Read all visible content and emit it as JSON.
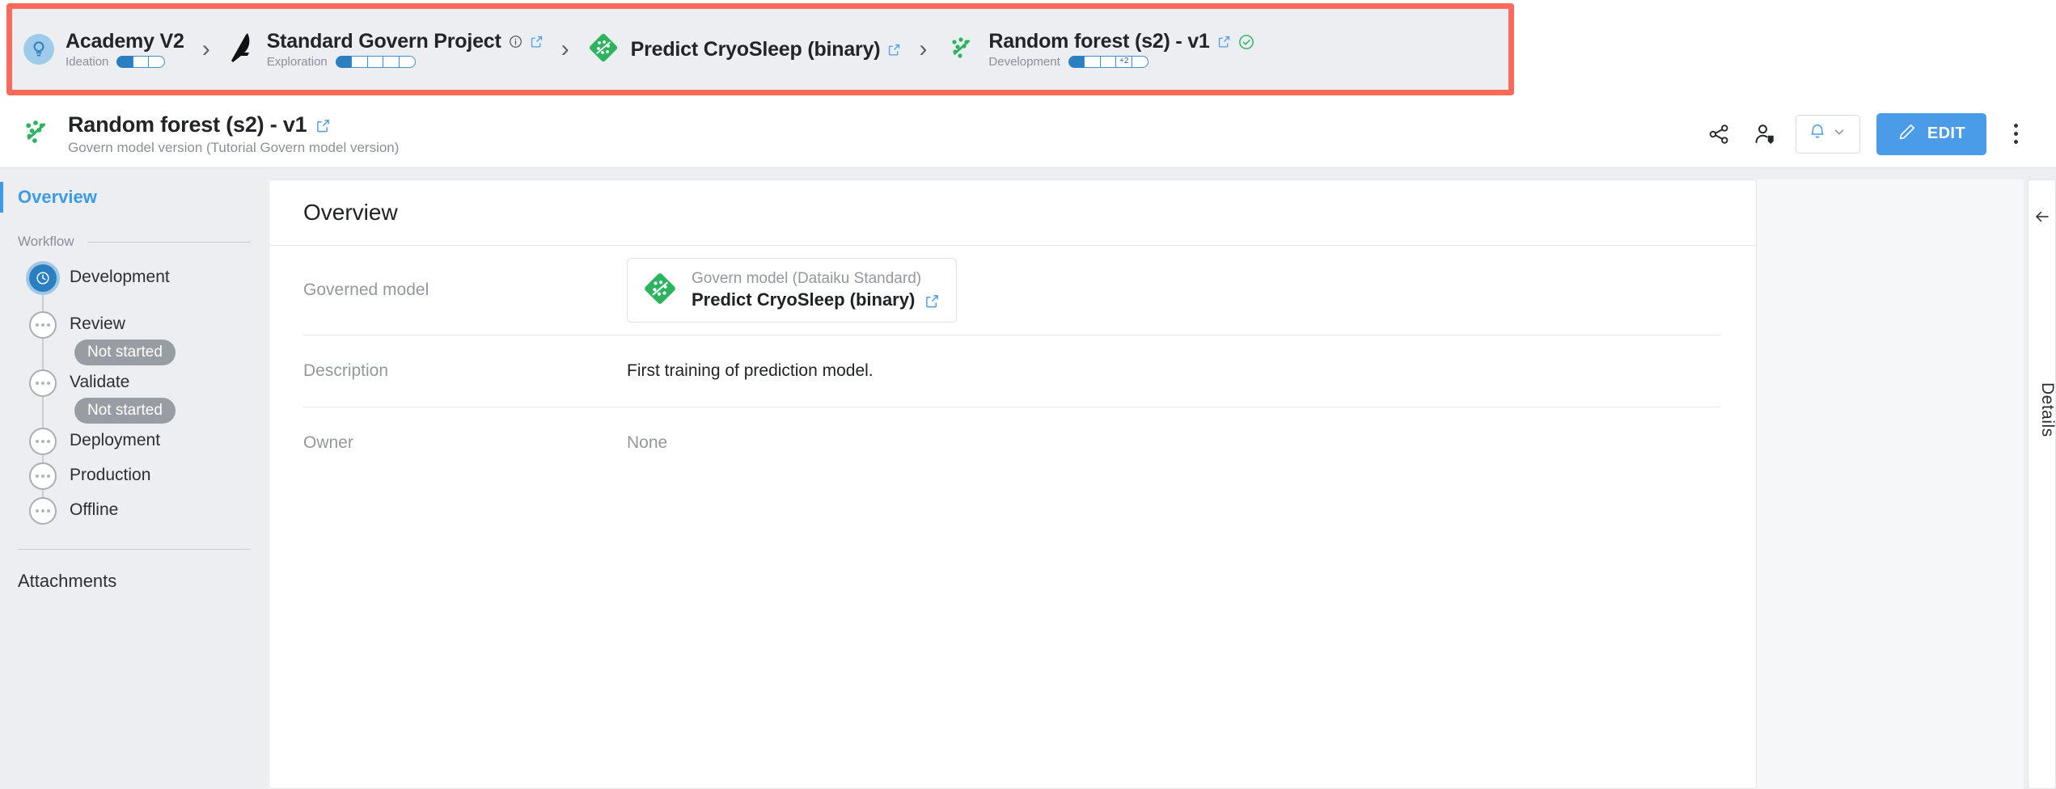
{
  "colors": {
    "accent_blue": "#3d9ae8",
    "edit_blue": "#4a9be8",
    "highlight_red": "#f96a5a",
    "green": "#2bb35e",
    "badge_gray": "#989da4"
  },
  "breadcrumb": {
    "items": [
      {
        "title": "Academy V2",
        "stage": "Ideation",
        "icon": "lightbulb-icon",
        "progress_total": 3,
        "progress_done": 1,
        "progress_extra": "",
        "has_external_link": false,
        "has_info": false,
        "has_status_check": false
      },
      {
        "title": "Standard Govern Project",
        "stage": "Exploration",
        "icon": "bird-feather-icon",
        "progress_total": 5,
        "progress_done": 1,
        "progress_extra": "",
        "has_external_link": true,
        "has_info": true,
        "has_status_check": false
      },
      {
        "title": "Predict CryoSleep (binary)",
        "stage": "",
        "icon": "govern-model-diamond-icon",
        "progress_total": 0,
        "progress_done": 0,
        "progress_extra": "",
        "has_external_link": true,
        "has_info": false,
        "has_status_check": false
      },
      {
        "title": "Random forest (s2) - v1",
        "stage": "Development",
        "icon": "model-version-scatter-icon",
        "progress_total": 5,
        "progress_done": 1,
        "progress_extra": "+2",
        "has_external_link": true,
        "has_info": false,
        "has_status_check": true
      }
    ],
    "separator": "›"
  },
  "header": {
    "icon": "model-version-scatter-icon",
    "title": "Random forest (s2) - v1",
    "subtitle": "Govern model version (Tutorial Govern model version)",
    "external_link_icon": "external-link-icon",
    "actions": {
      "share_icon": "share-nodes-icon",
      "assign_owner_icon": "user-tag-icon",
      "notification_icon": "bell-icon",
      "notification_caret_icon": "chevron-down-icon",
      "edit_icon": "pencil-icon",
      "edit_label": "EDIT",
      "more_icon": "kebab-menu-icon"
    }
  },
  "sidebar": {
    "overview_label": "Overview",
    "workflow_label": "Workflow",
    "steps": [
      {
        "label": "Development",
        "status": "",
        "state": "active",
        "icon": "clock-icon"
      },
      {
        "label": "Review",
        "status": "Not started",
        "state": "pending",
        "icon": "ellipsis-icon"
      },
      {
        "label": "Validate",
        "status": "Not started",
        "state": "pending",
        "icon": "ellipsis-icon"
      },
      {
        "label": "Deployment",
        "status": "",
        "state": "pending",
        "icon": "ellipsis-icon"
      },
      {
        "label": "Production",
        "status": "",
        "state": "pending",
        "icon": "ellipsis-icon"
      },
      {
        "label": "Offline",
        "status": "",
        "state": "pending",
        "icon": "ellipsis-icon"
      }
    ],
    "attachments_label": "Attachments"
  },
  "main": {
    "card_title": "Overview",
    "rows": [
      {
        "label": "Governed model",
        "type": "model_card",
        "model_kind": "Govern model (Dataiku Standard)",
        "model_name": "Predict CryoSleep (binary)",
        "model_icon": "govern-model-diamond-icon",
        "external_link_icon": "external-link-icon"
      },
      {
        "label": "Description",
        "type": "text",
        "value": "First training of prediction model.",
        "muted": false
      },
      {
        "label": "Owner",
        "type": "text",
        "value": "None",
        "muted": true
      }
    ]
  },
  "details_panel": {
    "collapse_icon": "arrow-left-icon",
    "label": "Details"
  }
}
